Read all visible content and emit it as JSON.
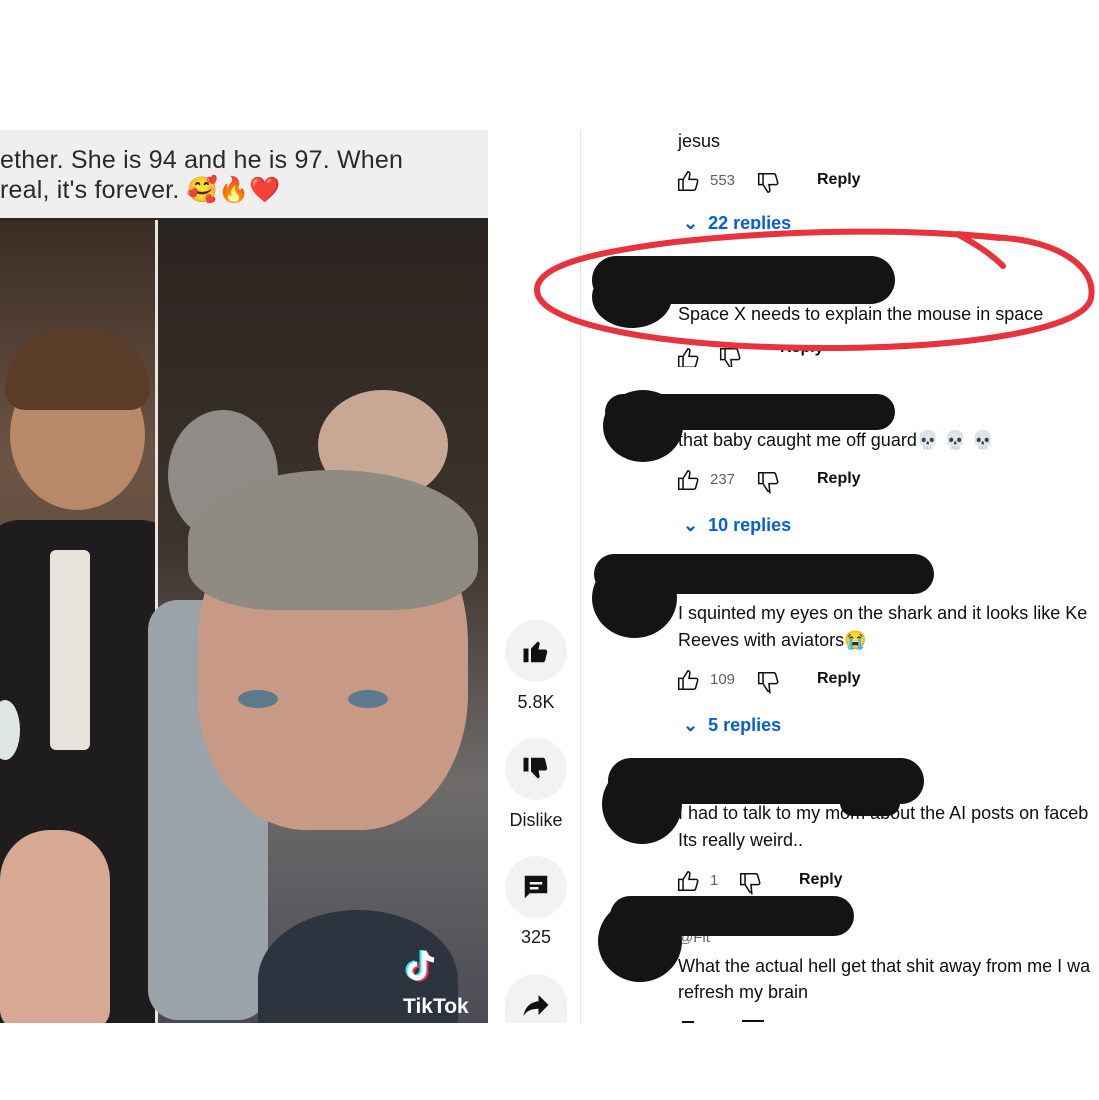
{
  "video": {
    "caption_line1": "ether. She is 94 and he is 97. When",
    "caption_line2": "real, it's forever. 🥰🔥❤️",
    "watermark": "TikTok",
    "likes": "5.8K",
    "dislike_label": "Dislike",
    "comments_count": "325"
  },
  "comments": [
    {
      "text": "jesus",
      "likes": "553",
      "reply_label": "Reply",
      "replies_label": "22 replies"
    },
    {
      "text": "Space X needs to explain the mouse in space",
      "reply_label": "Reply"
    },
    {
      "text": "that baby caught me off guard💀 💀 💀",
      "likes": "237",
      "reply_label": "Reply",
      "replies_label": "10 replies"
    },
    {
      "text_line1": "I squinted my eyes on the shark and it looks like Ke",
      "text_line2": "Reeves with aviators😭",
      "likes": "109",
      "reply_label": "Reply",
      "replies_label": "5 replies"
    },
    {
      "text_line1": "I had to talk to my mom about the AI posts on faceb",
      "text_line2": "Its really weird..",
      "likes": "1",
      "reply_label": "Reply"
    },
    {
      "handle": "@Fit",
      "text_line1": "What the actual hell get that shit away from me I wa",
      "text_line2": "refresh my brain"
    }
  ],
  "annotation": {
    "color": "#e8323c"
  },
  "colors": {
    "link_blue": "#065fd4",
    "text_dark": "#0f0f0f",
    "text_muted": "#606060"
  }
}
